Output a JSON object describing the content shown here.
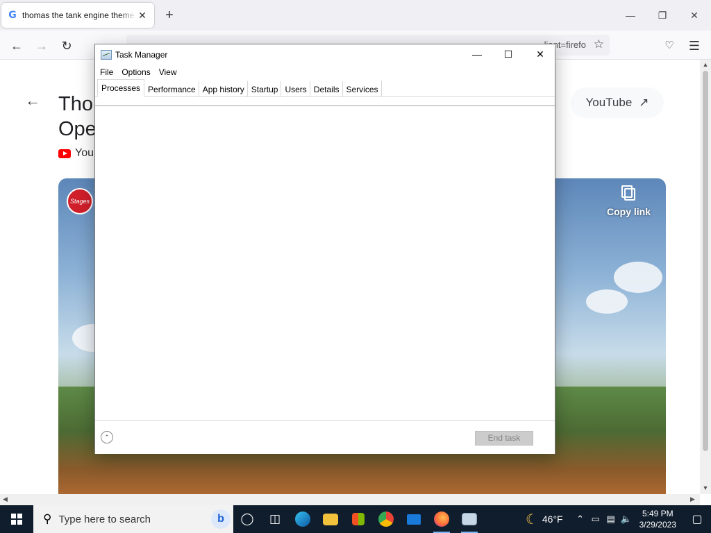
{
  "browser": {
    "tab_title": "thomas the tank engine theme",
    "tab_favicon": "G",
    "tab_close": "✕",
    "new_tab": "+",
    "url_text": "…lient=firefo",
    "colors": {
      "tabstrip": "#f0f0f4",
      "accent": "#4285f4"
    }
  },
  "page": {
    "title_line1": "Thor",
    "title_line2": "Ope",
    "source": "You",
    "youtube_button": "YouTube",
    "copy_link": "Copy link",
    "brand_badge": "Stages"
  },
  "task_manager": {
    "title": "Task Manager",
    "menu": [
      "File",
      "Options",
      "View"
    ],
    "tabs": [
      "Processes",
      "Performance",
      "App history",
      "Startup",
      "Users",
      "Details",
      "Services"
    ],
    "active_tab": "Processes",
    "end_task_label": "End task"
  },
  "taskbar": {
    "search_placeholder": "Type here to search",
    "temperature": "46°F",
    "time": "5:49 PM",
    "date": "3/29/2023"
  }
}
